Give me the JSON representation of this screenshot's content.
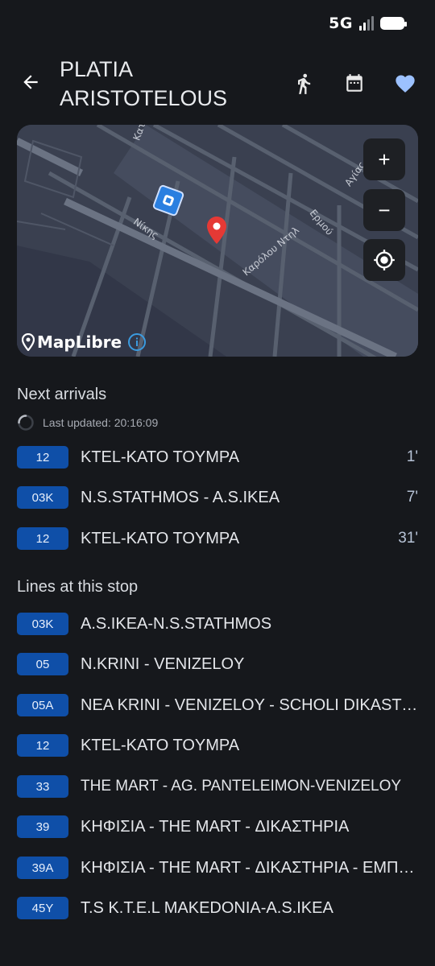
{
  "status": {
    "network": "5G"
  },
  "header": {
    "title": "PLATIA ARISTOTELOUS",
    "icons": [
      "back-arrow-icon",
      "walk-icon",
      "calendar-icon",
      "heart-icon"
    ],
    "accent": "#9cc1ff"
  },
  "map": {
    "street_labels": [
      "Κατου",
      "Νίκης",
      "Ερμού",
      "Καρόλου Ντηλ",
      "Αγίας"
    ],
    "zoom_in": "+",
    "zoom_out": "−",
    "attribution": "MapLibre",
    "marker_color": "#e53935"
  },
  "arrivals": {
    "title": "Next arrivals",
    "last_updated": "Last updated: 20:16:09",
    "items": [
      {
        "line": "12",
        "destination": "KTEL-KATO TOYMPA",
        "minutes": "1'"
      },
      {
        "line": "03K",
        "destination": "N.S.STATHMOS - A.S.IKEA",
        "minutes": "7'"
      },
      {
        "line": "12",
        "destination": "KTEL-KATO TOYMPA",
        "minutes": "31'"
      }
    ]
  },
  "lines": {
    "title": "Lines at this stop",
    "items": [
      {
        "line": "03K",
        "name": "A.S.IKEA-N.S.STATHMOS"
      },
      {
        "line": "05",
        "name": "N.KRINI - VENIZELOY"
      },
      {
        "line": "05A",
        "name": "NEA KRINI - VENIZELOY - SCHOLI DIKASTO…"
      },
      {
        "line": "12",
        "name": "KTEL-KATO TOYMPA"
      },
      {
        "line": "33",
        "name": "THE MART - AG. PANTELEIMON-VENIZELOY"
      },
      {
        "line": "39",
        "name": "ΚΗΦΙΣΙΑ - THE MART - ΔΙΚΑΣΤΗΡΙΑ"
      },
      {
        "line": "39A",
        "name": "ΚΗΦΙΣΙΑ - THE MART - ΔΙΚΑΣΤΗΡΙΑ - ΕΜΠ…"
      },
      {
        "line": "45Y",
        "name": "T.S K.T.E.L MAKEDONIA-A.S.IKEA"
      }
    ]
  },
  "colors": {
    "badge": "#0f4fa8",
    "background": "#16181c",
    "map_button": "#1e2024"
  }
}
